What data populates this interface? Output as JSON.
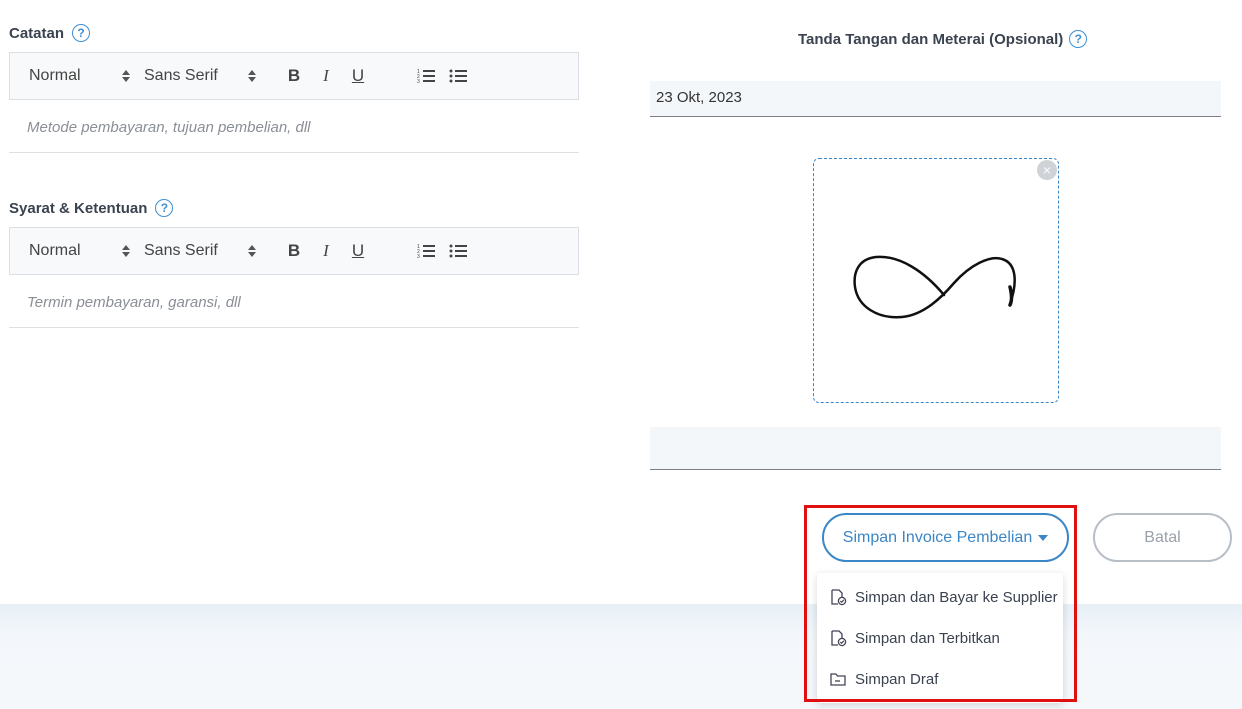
{
  "notes": {
    "label": "Catatan",
    "help": "?",
    "toolbar": {
      "style": "Normal",
      "font": "Sans Serif",
      "bold": "B",
      "italic": "I",
      "underline": "U"
    },
    "placeholder": "Metode pembayaran, tujuan pembelian, dll"
  },
  "terms": {
    "label": "Syarat & Ketentuan",
    "help": "?",
    "toolbar": {
      "style": "Normal",
      "font": "Sans Serif",
      "bold": "B",
      "italic": "I",
      "underline": "U"
    },
    "placeholder": "Termin pembayaran, garansi, dll"
  },
  "signature": {
    "title": "Tanda Tangan dan Meterai (Opsional)",
    "help": "?",
    "date": "23 Okt, 2023",
    "remove": "×"
  },
  "actions": {
    "save_label": "Simpan Invoice Pembelian",
    "cancel_label": "Batal",
    "menu": [
      {
        "label": "Simpan dan Bayar ke Supplier",
        "icon": "doc-check-icon"
      },
      {
        "label": "Simpan dan Terbitkan",
        "icon": "doc-check-icon"
      },
      {
        "label": "Simpan Draf",
        "icon": "folder-icon"
      }
    ]
  },
  "colors": {
    "accent": "#3b86c6",
    "highlight": "#e01010"
  }
}
